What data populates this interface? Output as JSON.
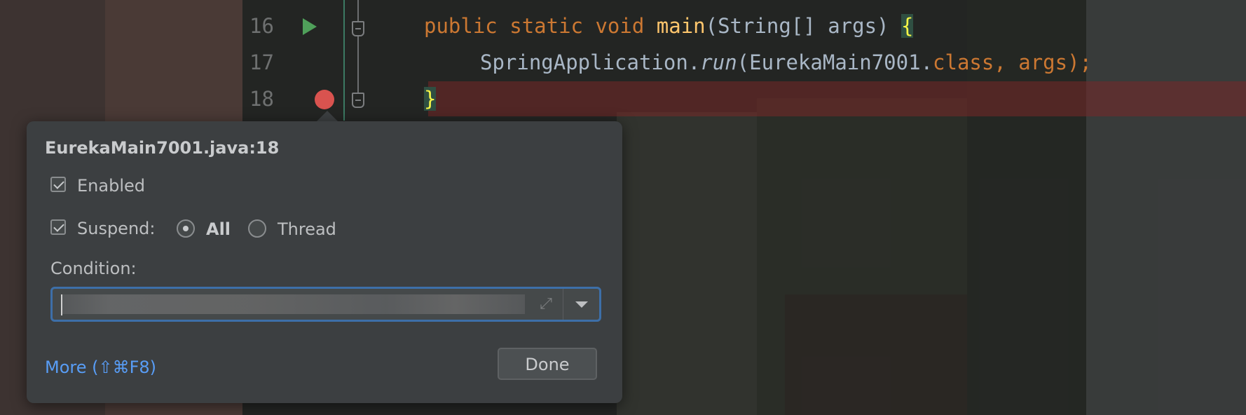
{
  "editor": {
    "lines": [
      {
        "number": "16",
        "code_parts": [
          "public",
          " ",
          "static",
          " ",
          "void",
          " ",
          "main",
          "(String[] args) ",
          "{"
        ]
      },
      {
        "number": "17",
        "code_parts": [
          "SpringApplication.",
          "run",
          "(EurekaMain7001.",
          "class",
          ", args);"
        ]
      },
      {
        "number": "18",
        "code_parts": [
          "}"
        ]
      }
    ]
  },
  "popup": {
    "title": "EurekaMain7001.java:18",
    "enabled_label": "Enabled",
    "enabled_checked": true,
    "suspend_label": "Suspend:",
    "suspend_checked": true,
    "suspend_all_label": "All",
    "suspend_thread_label": "Thread",
    "suspend_selected": "All",
    "condition_label": "Condition:",
    "condition_value": "",
    "more_label": "More (⇧⌘F8)",
    "done_label": "Done"
  },
  "colors": {
    "keyword": "#cc7832",
    "method": "#ffc66d",
    "text": "#a9b7c6",
    "link": "#589df6",
    "breakpoint": "#d9534f",
    "run": "#4fa05a"
  }
}
